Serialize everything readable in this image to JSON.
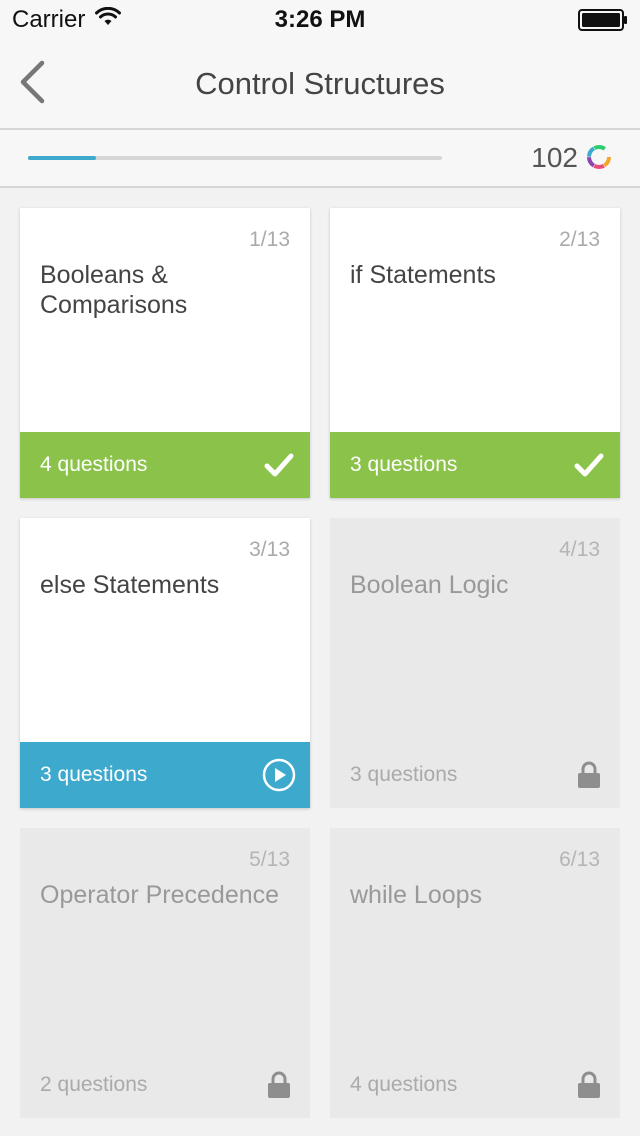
{
  "status_bar": {
    "carrier": "Carrier",
    "time": "3:26 PM"
  },
  "nav": {
    "title": "Control Structures"
  },
  "progress": {
    "fraction": 0.165,
    "xp": "102"
  },
  "colors": {
    "accent_blue": "#3da9cd",
    "complete_green": "#8bc34a",
    "locked_gray": "#e9e9e9"
  },
  "lessons": [
    {
      "number": "1/13",
      "title": "Booleans & Comparisons",
      "questions": "4 questions",
      "state": "completed",
      "icon": "checkmark-icon"
    },
    {
      "number": "2/13",
      "title": "if Statements",
      "questions": "3 questions",
      "state": "completed",
      "icon": "checkmark-icon"
    },
    {
      "number": "3/13",
      "title": "else Statements",
      "questions": "3 questions",
      "state": "current",
      "icon": "play-icon"
    },
    {
      "number": "4/13",
      "title": "Boolean Logic",
      "questions": "3 questions",
      "state": "locked",
      "icon": "lock-icon"
    },
    {
      "number": "5/13",
      "title": "Operator Precedence",
      "questions": "2 questions",
      "state": "locked",
      "icon": "lock-icon"
    },
    {
      "number": "6/13",
      "title": "while Loops",
      "questions": "4 questions",
      "state": "locked",
      "icon": "lock-icon"
    }
  ]
}
